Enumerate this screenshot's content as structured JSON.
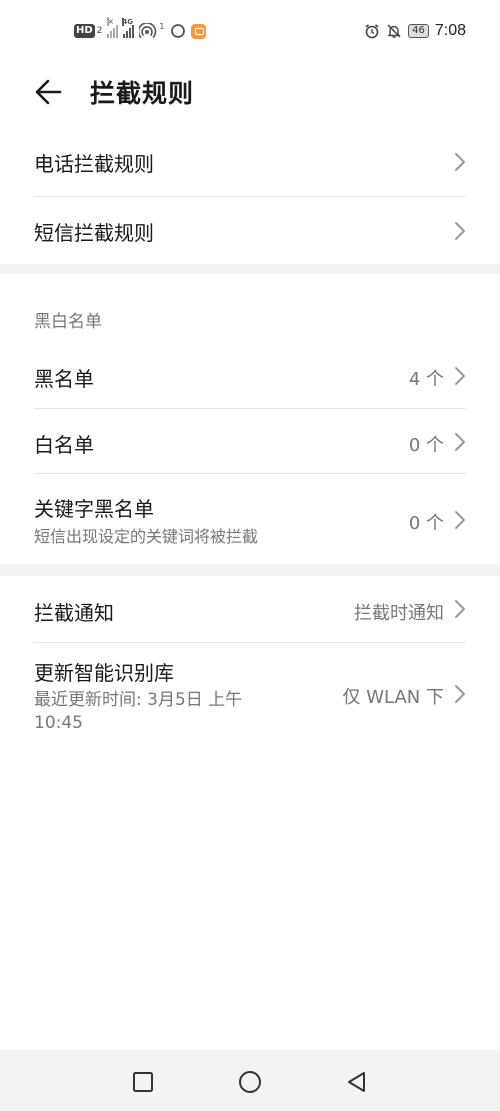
{
  "status_bar": {
    "hd_label": "HD",
    "hd_sub": "2",
    "network_label": "4G",
    "hotspot_sup": "1",
    "battery": "46",
    "time": "7:08"
  },
  "header": {
    "title": "拦截规则"
  },
  "rules": {
    "items": [
      {
        "label": "电话拦截规则"
      },
      {
        "label": "短信拦截规则"
      }
    ]
  },
  "lists": {
    "header": "黑白名单",
    "items": [
      {
        "label": "黑名单",
        "value": "4 个"
      },
      {
        "label": "白名单",
        "value": "0 个"
      },
      {
        "label": "关键字黑名单",
        "subtitle": "短信出现设定的关键词将被拦截",
        "value": "0 个"
      }
    ]
  },
  "settings": {
    "notify": {
      "label": "拦截通知",
      "value": "拦截时通知"
    },
    "update": {
      "label": "更新智能识别库",
      "subtitle_line1": "最近更新时间: 3月5日 上午",
      "subtitle_line2": "10:45",
      "value": "仅 WLAN 下"
    }
  },
  "colors": {
    "background": "#f3f3f3",
    "card": "#ffffff",
    "primary_text": "#1a1a1a",
    "secondary_text": "#777777",
    "divider": "#e6e6e6"
  },
  "icons": [
    "back-arrow-icon",
    "chevron-right-icon",
    "alarm-icon",
    "bell-off-icon",
    "hotspot-icon",
    "circle-icon",
    "app-badge-icon",
    "nav-square-icon",
    "nav-circle-icon",
    "nav-triangle-icon"
  ]
}
